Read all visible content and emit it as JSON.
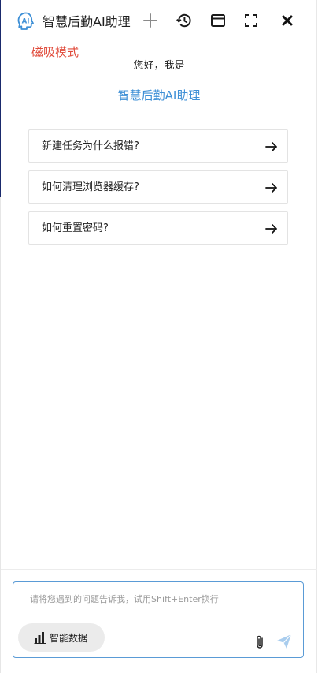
{
  "header": {
    "title": "智慧后勤AI助理",
    "logo_text": "AI",
    "buttons": [
      "new-chat",
      "history",
      "window",
      "fullscreen",
      "close"
    ]
  },
  "mode_label": "磁吸模式",
  "greeting": "您好，我是",
  "assistant_name": "智慧后勤AI助理",
  "suggestions": [
    {
      "label": "新建任务为什么报错?"
    },
    {
      "label": "如何清理浏览器缓存?"
    },
    {
      "label": "如何重置密码?"
    }
  ],
  "input": {
    "placeholder": "请将您遇到的问题告诉我，试用Shift+Enter换行",
    "value": ""
  },
  "smart_data_label": "智能数据",
  "colors": {
    "accent": "#3d8fd6",
    "mode_label": "#e04a3a",
    "input_border": "#5a9bd6",
    "send_icon": "#a9cdee"
  }
}
